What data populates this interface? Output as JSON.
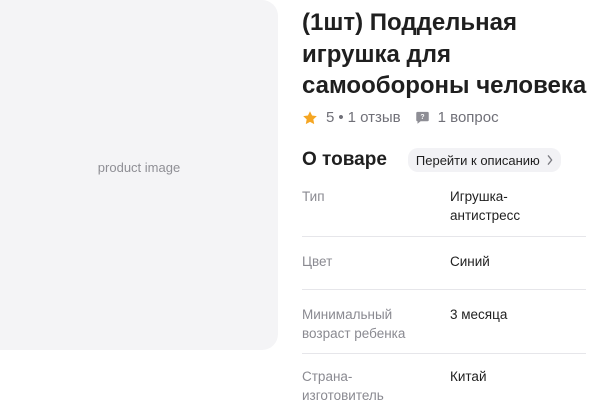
{
  "product": {
    "title_lines": [
      "(1шт) Поддельная",
      "игрушка для",
      "самообороны человека"
    ]
  },
  "rating": {
    "value": "5",
    "separator": "•",
    "reviews": "1 отзыв",
    "questions": "1 вопрос",
    "star_color": "#f5a623"
  },
  "about": {
    "title": "О товаре",
    "description_link": "Перейти к описанию"
  },
  "specs": [
    {
      "key_lines": [
        "Тип"
      ],
      "value_lines": [
        "Игрушка-",
        "антистресс"
      ]
    },
    {
      "key_lines": [
        "Цвет"
      ],
      "value_lines": [
        "Синий"
      ]
    },
    {
      "key_lines": [
        "Минимальный",
        "возраст ребенка"
      ],
      "value_lines": [
        "3 месяца"
      ]
    },
    {
      "key_lines": [
        "Страна-",
        "изготовитель"
      ],
      "value_lines": [
        "Китай"
      ]
    }
  ]
}
